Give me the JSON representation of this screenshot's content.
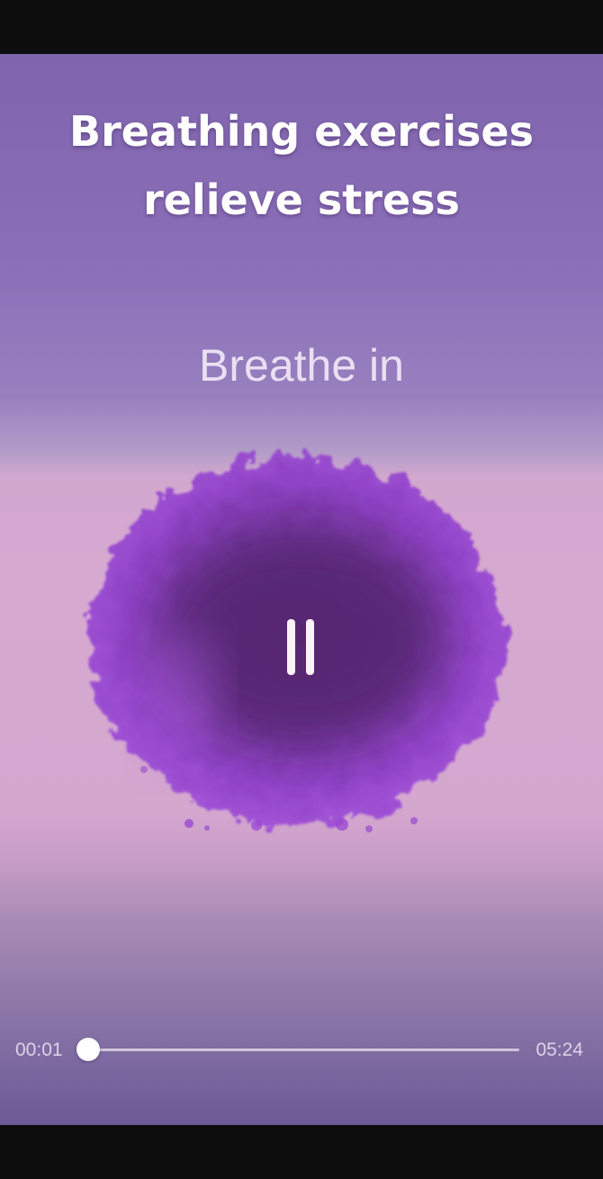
{
  "screen": {
    "headline_line1": "Breathing exercises",
    "headline_line2": "relieve stress",
    "phase_label": "Breathe in"
  },
  "player": {
    "state": "playing",
    "control_icon": "pause-icon",
    "current_time": "00:01",
    "total_time": "05:24",
    "progress_fraction": 0.003
  },
  "colors": {
    "background_top": "#7f65ad",
    "background_band": "#d6a9d1",
    "background_bottom": "#6c5a96",
    "blob_outer": "#a050d8",
    "blob_core": "#5a2878",
    "text_primary": "#ffffff"
  }
}
